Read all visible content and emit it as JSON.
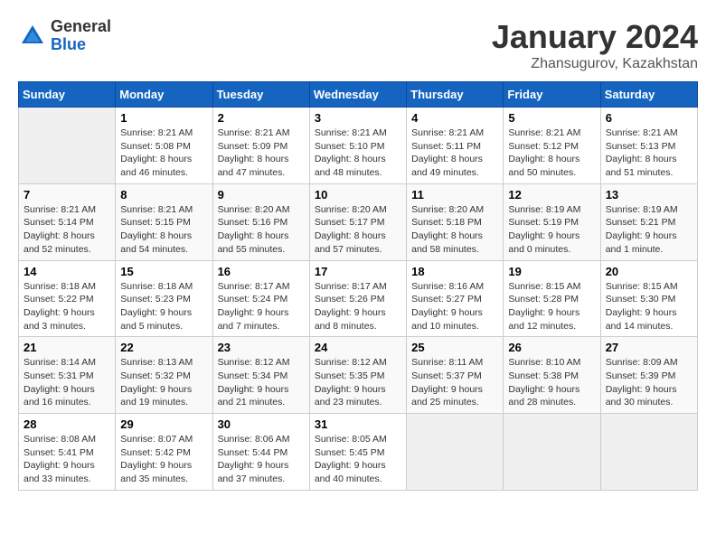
{
  "header": {
    "logo": {
      "general": "General",
      "blue": "Blue"
    },
    "title": "January 2024",
    "location": "Zhansugurov, Kazakhstan"
  },
  "days_of_week": [
    "Sunday",
    "Monday",
    "Tuesday",
    "Wednesday",
    "Thursday",
    "Friday",
    "Saturday"
  ],
  "weeks": [
    [
      {
        "day": "",
        "info": ""
      },
      {
        "day": "1",
        "info": "Sunrise: 8:21 AM\nSunset: 5:08 PM\nDaylight: 8 hours\nand 46 minutes."
      },
      {
        "day": "2",
        "info": "Sunrise: 8:21 AM\nSunset: 5:09 PM\nDaylight: 8 hours\nand 47 minutes."
      },
      {
        "day": "3",
        "info": "Sunrise: 8:21 AM\nSunset: 5:10 PM\nDaylight: 8 hours\nand 48 minutes."
      },
      {
        "day": "4",
        "info": "Sunrise: 8:21 AM\nSunset: 5:11 PM\nDaylight: 8 hours\nand 49 minutes."
      },
      {
        "day": "5",
        "info": "Sunrise: 8:21 AM\nSunset: 5:12 PM\nDaylight: 8 hours\nand 50 minutes."
      },
      {
        "day": "6",
        "info": "Sunrise: 8:21 AM\nSunset: 5:13 PM\nDaylight: 8 hours\nand 51 minutes."
      }
    ],
    [
      {
        "day": "7",
        "info": "Sunrise: 8:21 AM\nSunset: 5:14 PM\nDaylight: 8 hours\nand 52 minutes."
      },
      {
        "day": "8",
        "info": "Sunrise: 8:21 AM\nSunset: 5:15 PM\nDaylight: 8 hours\nand 54 minutes."
      },
      {
        "day": "9",
        "info": "Sunrise: 8:20 AM\nSunset: 5:16 PM\nDaylight: 8 hours\nand 55 minutes."
      },
      {
        "day": "10",
        "info": "Sunrise: 8:20 AM\nSunset: 5:17 PM\nDaylight: 8 hours\nand 57 minutes."
      },
      {
        "day": "11",
        "info": "Sunrise: 8:20 AM\nSunset: 5:18 PM\nDaylight: 8 hours\nand 58 minutes."
      },
      {
        "day": "12",
        "info": "Sunrise: 8:19 AM\nSunset: 5:19 PM\nDaylight: 9 hours\nand 0 minutes."
      },
      {
        "day": "13",
        "info": "Sunrise: 8:19 AM\nSunset: 5:21 PM\nDaylight: 9 hours\nand 1 minute."
      }
    ],
    [
      {
        "day": "14",
        "info": "Sunrise: 8:18 AM\nSunset: 5:22 PM\nDaylight: 9 hours\nand 3 minutes."
      },
      {
        "day": "15",
        "info": "Sunrise: 8:18 AM\nSunset: 5:23 PM\nDaylight: 9 hours\nand 5 minutes."
      },
      {
        "day": "16",
        "info": "Sunrise: 8:17 AM\nSunset: 5:24 PM\nDaylight: 9 hours\nand 7 minutes."
      },
      {
        "day": "17",
        "info": "Sunrise: 8:17 AM\nSunset: 5:26 PM\nDaylight: 9 hours\nand 8 minutes."
      },
      {
        "day": "18",
        "info": "Sunrise: 8:16 AM\nSunset: 5:27 PM\nDaylight: 9 hours\nand 10 minutes."
      },
      {
        "day": "19",
        "info": "Sunrise: 8:15 AM\nSunset: 5:28 PM\nDaylight: 9 hours\nand 12 minutes."
      },
      {
        "day": "20",
        "info": "Sunrise: 8:15 AM\nSunset: 5:30 PM\nDaylight: 9 hours\nand 14 minutes."
      }
    ],
    [
      {
        "day": "21",
        "info": "Sunrise: 8:14 AM\nSunset: 5:31 PM\nDaylight: 9 hours\nand 16 minutes."
      },
      {
        "day": "22",
        "info": "Sunrise: 8:13 AM\nSunset: 5:32 PM\nDaylight: 9 hours\nand 19 minutes."
      },
      {
        "day": "23",
        "info": "Sunrise: 8:12 AM\nSunset: 5:34 PM\nDaylight: 9 hours\nand 21 minutes."
      },
      {
        "day": "24",
        "info": "Sunrise: 8:12 AM\nSunset: 5:35 PM\nDaylight: 9 hours\nand 23 minutes."
      },
      {
        "day": "25",
        "info": "Sunrise: 8:11 AM\nSunset: 5:37 PM\nDaylight: 9 hours\nand 25 minutes."
      },
      {
        "day": "26",
        "info": "Sunrise: 8:10 AM\nSunset: 5:38 PM\nDaylight: 9 hours\nand 28 minutes."
      },
      {
        "day": "27",
        "info": "Sunrise: 8:09 AM\nSunset: 5:39 PM\nDaylight: 9 hours\nand 30 minutes."
      }
    ],
    [
      {
        "day": "28",
        "info": "Sunrise: 8:08 AM\nSunset: 5:41 PM\nDaylight: 9 hours\nand 33 minutes."
      },
      {
        "day": "29",
        "info": "Sunrise: 8:07 AM\nSunset: 5:42 PM\nDaylight: 9 hours\nand 35 minutes."
      },
      {
        "day": "30",
        "info": "Sunrise: 8:06 AM\nSunset: 5:44 PM\nDaylight: 9 hours\nand 37 minutes."
      },
      {
        "day": "31",
        "info": "Sunrise: 8:05 AM\nSunset: 5:45 PM\nDaylight: 9 hours\nand 40 minutes."
      },
      {
        "day": "",
        "info": ""
      },
      {
        "day": "",
        "info": ""
      },
      {
        "day": "",
        "info": ""
      }
    ]
  ]
}
